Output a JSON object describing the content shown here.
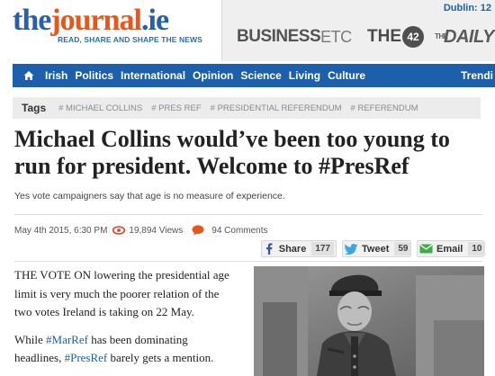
{
  "header": {
    "logo": {
      "the": "the",
      "journal": "journal",
      "ie": ".ie",
      "tagline": "READ, SHARE AND SHAPE THE NEWS"
    },
    "dublin": "Dublin: 12",
    "brands": {
      "business": "BUSINESS",
      "business_etc": "ETC",
      "the42_the": "THE",
      "the42_num": "42",
      "daily": "DAILY"
    }
  },
  "nav": {
    "items": [
      "Irish",
      "Politics",
      "International",
      "Opinion",
      "Science",
      "Living",
      "Culture"
    ],
    "right": "Trendi"
  },
  "tags": {
    "label": "Tags",
    "items": [
      "# MICHAEL COLLINS",
      "# PRES REF",
      "# PRESIDENTIAL REFERENDUM",
      "# REFERENDUM"
    ]
  },
  "article": {
    "title": "Michael Collins would’ve been too young to run for president. Welcome to #PresRef",
    "subtitle": "Yes vote campaigners say that age is no measure of experience.",
    "date": "May 4th 2015, 6:30 PM",
    "views": "19,894 Views",
    "comments": "94 Comments",
    "p1": "THE VOTE ON lowering the presidential age limit is very much the poorer relation of the two votes Ireland is taking on 22 May.",
    "p2_a": "While ",
    "p2_hash1": "#MarRef",
    "p2_b": " has been dominating headlines, ",
    "p2_hash2": "#PresRef",
    "p2_c": " barely gets a mention."
  },
  "share": {
    "facebook": {
      "label": "Share",
      "count": "177"
    },
    "twitter": {
      "label": "Tweet",
      "count": "59"
    },
    "email": {
      "label": "Email",
      "count": "10"
    }
  },
  "colors": {
    "brand_blue": "#1d5faa",
    "logo_orange": "#e8561b",
    "views_red": "#e0432a"
  },
  "icons": [
    "home-icon",
    "eye-icon",
    "comment-bubble-icon",
    "facebook-icon",
    "twitter-icon",
    "email-icon"
  ]
}
